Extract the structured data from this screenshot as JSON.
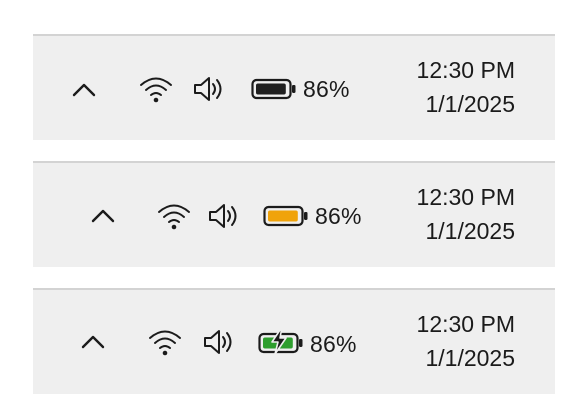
{
  "trays": [
    {
      "variant": "normal",
      "show_hidden_icons": "chevron-up-icon",
      "network": "wifi-icon",
      "sound": "speaker-icon",
      "battery": {
        "state": "discharging",
        "icon": "battery-icon",
        "fill_color": "#1f1f1f",
        "level_fraction": 0.86,
        "percent_label": "86%"
      },
      "clock": {
        "time": "12:30 PM",
        "date": "1/1/2025"
      }
    },
    {
      "variant": "battery-saver",
      "show_hidden_icons": "chevron-up-icon",
      "network": "wifi-icon",
      "sound": "speaker-icon",
      "battery": {
        "state": "saver",
        "icon": "battery-icon",
        "fill_color": "#f0a30a",
        "level_fraction": 0.86,
        "percent_label": "86%"
      },
      "clock": {
        "time": "12:30 PM",
        "date": "1/1/2025"
      }
    },
    {
      "variant": "charging",
      "show_hidden_icons": "chevron-up-icon",
      "network": "wifi-icon",
      "sound": "speaker-icon",
      "battery": {
        "state": "charging",
        "icon": "battery-charging-icon",
        "fill_color": "#2e9e2e",
        "level_fraction": 0.86,
        "percent_label": "86%"
      },
      "clock": {
        "time": "12:30 PM",
        "date": "1/1/2025"
      }
    }
  ]
}
